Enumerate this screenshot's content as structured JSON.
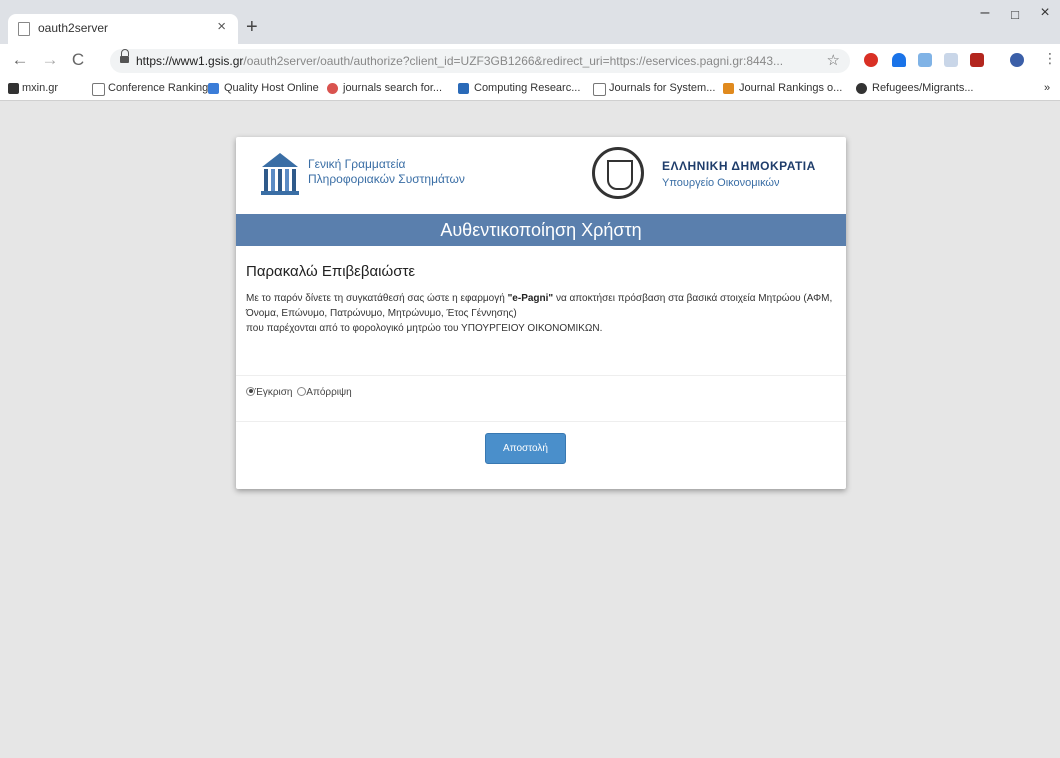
{
  "browser": {
    "tab_title": "oauth2server",
    "tab_close": "×",
    "new_tab": "+",
    "win_min": "–",
    "win_max": "□",
    "win_close": "×",
    "url_host": "https://www1.gsis.gr",
    "url_path": "/oauth2server/oauth/authorize?client_id=UZF3GB1266&redirect_uri=https://eservices.pagni.gr:8443...",
    "star": "☆"
  },
  "bookmarks": [
    {
      "label": "mxin.gr",
      "color": "#333333"
    },
    {
      "label": "Conference Ranking",
      "color": "#777777"
    },
    {
      "label": "Quality Host Online",
      "color": "#3b7dd8"
    },
    {
      "label": "journals search for...",
      "color": "#d9534f"
    },
    {
      "label": "Computing Researc...",
      "color": "#2a6ab8"
    },
    {
      "label": "Journals for System...",
      "color": "#777777"
    },
    {
      "label": "Journal Rankings o...",
      "color": "#e08a1e"
    },
    {
      "label": "Refugees/Migrants...",
      "color": "#333333"
    }
  ],
  "header": {
    "org_line1": "Γενική Γραμματεία",
    "org_line2": "Πληροφοριακών Συστημάτων",
    "gov_title": "ΕΛΛΗΝΙΚΗ ΔΗΜΟΚΡΑΤΙΑ",
    "gov_sub": "Υπουργείο Οικονομικών"
  },
  "banner": "Αυθεντικοποίηση Χρήστη",
  "confirm": {
    "title": "Παρακαλώ Επιβεβαιώστε",
    "text_pre": "Με το παρόν δίνετε τη συγκατάθεσή σας ώστε η εφαρμογή ",
    "app_name": "\"e-Pagni\"",
    "text_post": " να αποκτήσει πρόσβαση στα βασικά στοιχεία Μητρώου (ΑΦΜ, Όνομα, Επώνυμο, Πατρώνυμο, Μητρώνυμο, Έτος Γέννησης)",
    "text_line3": "που παρέχονται από το φορολογικό μητρώο του ΥΠΟΥΡΓΕΙΟΥ ΟΙΚΟΝΟΜΙΚΩΝ."
  },
  "radios": {
    "approve": "Έγκριση",
    "reject": "Απόρριψη",
    "selected": "approve"
  },
  "submit_label": "Αποστολή",
  "colors": {
    "banner": "#5a7fad",
    "button": "#4a8fcb",
    "org_text": "#3a6ea5"
  }
}
